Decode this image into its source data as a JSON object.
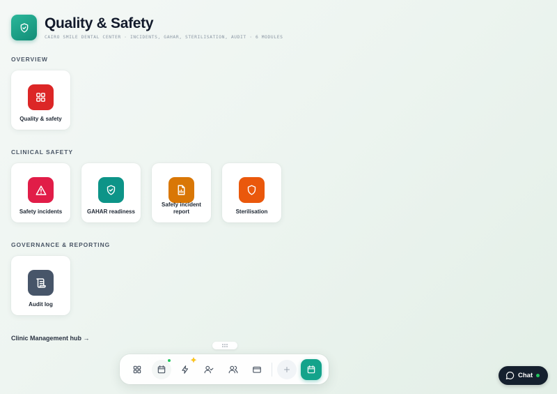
{
  "header": {
    "title": "Quality & Safety",
    "subtitle": "CAIRO SMILE DENTAL CENTER · INCIDENTS, GAHAR, STERILISATION, AUDIT · 6 MODULES",
    "logo_icon": "shield-check-icon"
  },
  "sections": [
    {
      "title": "OVERVIEW",
      "cards": [
        {
          "label": "Quality & safety",
          "icon": "grid-icon",
          "color": "#dc2626"
        }
      ]
    },
    {
      "title": "CLINICAL SAFETY",
      "cards": [
        {
          "label": "Safety incidents",
          "icon": "warning-icon",
          "color": "#e11d48"
        },
        {
          "label": "GAHAR readiness",
          "icon": "shield-check-icon",
          "color": "#0d9488"
        },
        {
          "label": "Safety incident report",
          "icon": "report-icon",
          "color": "#d97706"
        },
        {
          "label": "Sterilisation",
          "icon": "shield-icon",
          "color": "#ea580c"
        }
      ]
    },
    {
      "title": "GOVERNANCE & REPORTING",
      "cards": [
        {
          "label": "Audit log",
          "icon": "scroll-icon",
          "color": "#475569"
        }
      ]
    }
  ],
  "hub_link": "Clinic Management hub →",
  "dock": {
    "items": [
      {
        "icon": "grid-icon"
      },
      {
        "icon": "calendar-icon",
        "badge_color": "#22c55e"
      },
      {
        "icon": "lightning-icon",
        "badge": "sparkle"
      },
      {
        "icon": "user-check-icon"
      },
      {
        "icon": "users-icon"
      },
      {
        "icon": "card-icon"
      },
      {
        "icon": "plus-icon"
      },
      {
        "icon": "calendar-icon",
        "active": true
      }
    ],
    "accent": "#14a38b"
  },
  "chat": {
    "label": "Chat",
    "status_color": "#22c55e"
  }
}
